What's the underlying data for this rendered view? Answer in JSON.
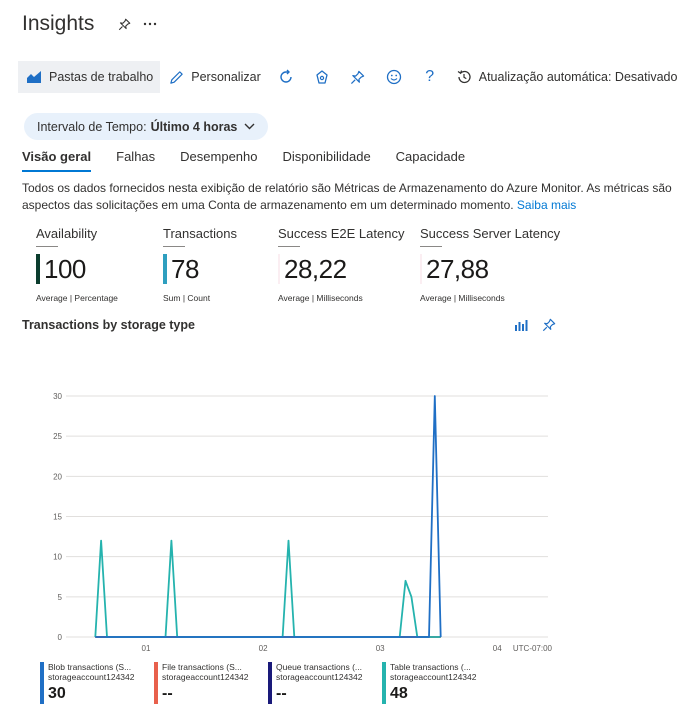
{
  "page": {
    "title": "Insights",
    "pin_icon": "pin-icon",
    "more_icon": "more-icon"
  },
  "toolbar": {
    "workbooks": "Pastas de trabalho",
    "customize": "Personalizar",
    "auto_refresh": "Atualização automática: Desativado",
    "icons": [
      "workbooks-icon",
      "edit-icon",
      "refresh-icon",
      "feedback-icon",
      "pin-icon",
      "smiley-icon",
      "help-icon",
      "history-icon"
    ]
  },
  "time_range": {
    "label": "Intervalo de Tempo:",
    "value": "Último 4 horas"
  },
  "tabs": [
    {
      "label": "Visão geral",
      "active": true
    },
    {
      "label": "Falhas",
      "active": false
    },
    {
      "label": "Desempenho",
      "active": false
    },
    {
      "label": "Disponibilidade",
      "active": false
    },
    {
      "label": "Capacidade",
      "active": false
    }
  ],
  "description": {
    "text": "Todos os dados fornecidos nesta exibição de relatório são Métricas de Armazenamento do Azure Monitor. As métricas são aspectos das solicitações em uma Conta de armazenamento em um determinado momento.",
    "link": "Saiba mais"
  },
  "kpis": [
    {
      "label": "Availability",
      "value": "100",
      "sub": "Average | Percentage",
      "color": "#0b3d2e"
    },
    {
      "label": "Transactions",
      "value": "78",
      "sub": "Sum | Count",
      "color": "#2e9fbf"
    },
    {
      "label": "Success E2E Latency",
      "value": "28,22",
      "sub": "Average | Milliseconds",
      "color": ""
    },
    {
      "label": "Success Server Latency",
      "value": "27,88",
      "sub": "Average | Milliseconds",
      "color": ""
    }
  ],
  "chart": {
    "title": "Transactions by storage type"
  },
  "chart_data": {
    "type": "line",
    "title": "Transactions by storage type",
    "ylim": [
      0,
      30
    ],
    "yticks": [
      0,
      5,
      10,
      15,
      20,
      25,
      30
    ],
    "x_tick_labels": [
      "01",
      "02",
      "03",
      "04"
    ],
    "x_unit_label": "UTC-07:00",
    "grid": true,
    "x": [
      "00:34",
      "00:37",
      "00:40",
      "01:10",
      "01:13",
      "01:16",
      "02:10",
      "02:13",
      "02:16",
      "03:10",
      "03:13",
      "03:16",
      "03:19",
      "03:25",
      "03:28",
      "03:31"
    ],
    "series": [
      {
        "name": "Blob transactions (S...",
        "color": "#1f6fc5",
        "values": [
          0,
          0,
          0,
          0,
          0,
          0,
          0,
          0,
          0,
          0,
          0,
          0,
          0,
          0,
          30,
          0
        ]
      },
      {
        "name": "File transactions (S...",
        "color": "#e8604c",
        "values": [
          0,
          0,
          0,
          0,
          0,
          0,
          0,
          0,
          0,
          0,
          0,
          0,
          0,
          0,
          0,
          0
        ]
      },
      {
        "name": "Queue transactions (...",
        "color": "#1a1a7a",
        "values": [
          0,
          0,
          0,
          0,
          0,
          0,
          0,
          0,
          0,
          0,
          0,
          0,
          0,
          0,
          0,
          0
        ]
      },
      {
        "name": "Table transactions (...",
        "color": "#25b3ae",
        "values": [
          0,
          12,
          0,
          0,
          12,
          0,
          0,
          12,
          0,
          0,
          7,
          5,
          0,
          0,
          0,
          0
        ]
      }
    ]
  },
  "legend": [
    {
      "name": "Blob transactions (S...",
      "account": "storageaccount124342",
      "value": "30",
      "color": "#1f6fc5"
    },
    {
      "name": "File transactions (S...",
      "account": "storageaccount124342",
      "value": "--",
      "color": "#e8604c"
    },
    {
      "name": "Queue transactions (...",
      "account": "storageaccount124342",
      "value": "--",
      "color": "#1a1a7a"
    },
    {
      "name": "Table transactions (...",
      "account": "storageaccount124342",
      "value": "48",
      "color": "#25b3ae"
    }
  ],
  "icons": {
    "chart_metrics": "metrics-icon",
    "chart_pin": "pin-icon"
  }
}
